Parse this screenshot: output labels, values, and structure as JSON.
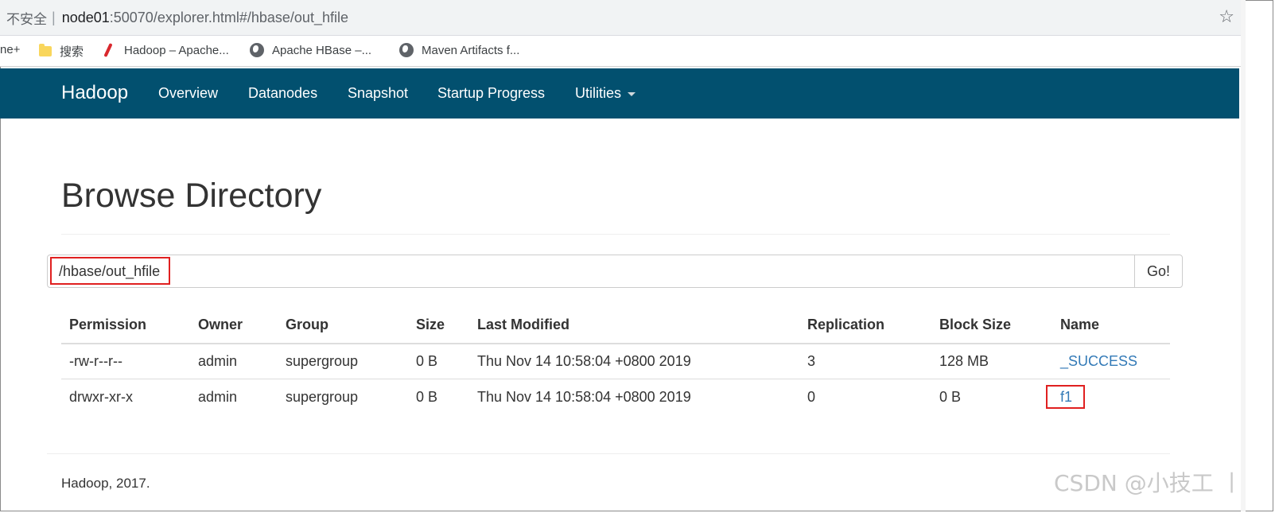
{
  "browser": {
    "insecure_label": "不安全",
    "separator": "|",
    "url_host": "node01",
    "url_rest": ":50070/explorer.html#/hbase/out_hfile",
    "bookmarks": [
      {
        "label": "ne+",
        "icon": "none"
      },
      {
        "label": "搜索",
        "icon": "folder-icon"
      },
      {
        "label": "Hadoop – Apache...",
        "icon": "feather-icon"
      },
      {
        "label": "Apache HBase –...",
        "icon": "globe-icon"
      },
      {
        "label": "Maven Artifacts f...",
        "icon": "globe-icon"
      }
    ]
  },
  "navbar": {
    "brand": "Hadoop",
    "items": [
      "Overview",
      "Datanodes",
      "Snapshot",
      "Startup Progress",
      "Utilities"
    ],
    "bg_color": "#02506f"
  },
  "page": {
    "title": "Browse Directory",
    "path_value": "/hbase/out_hfile",
    "go_label": "Go!"
  },
  "table": {
    "headers": [
      "Permission",
      "Owner",
      "Group",
      "Size",
      "Last Modified",
      "Replication",
      "Block Size",
      "Name"
    ],
    "rows": [
      [
        "-rw-r--r--",
        "admin",
        "supergroup",
        "0 B",
        "Thu Nov 14 10:58:04 +0800 2019",
        "3",
        "128 MB",
        "_SUCCESS"
      ],
      [
        "drwxr-xr-x",
        "admin",
        "supergroup",
        "0 B",
        "Thu Nov 14 10:58:04 +0800 2019",
        "0",
        "0 B",
        "f1"
      ]
    ]
  },
  "footer": "Hadoop, 2017.",
  "watermark": "CSDN @小技工 丨",
  "colors": {
    "link": "#337ab7",
    "highlight": "#e02020"
  }
}
